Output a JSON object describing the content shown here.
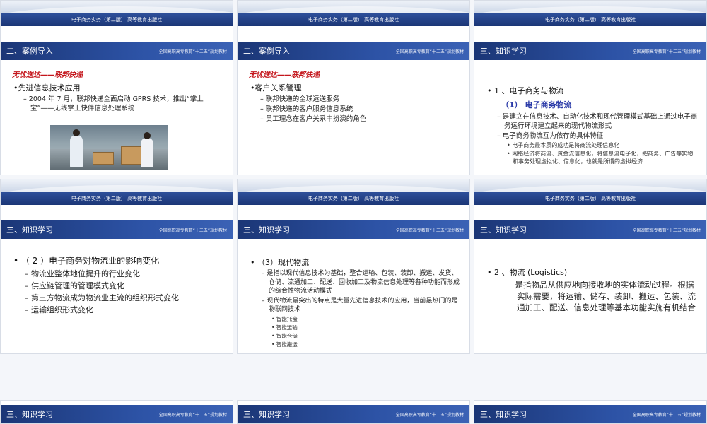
{
  "banner_text": "电子商务实务（第二版）   高等教育出版社",
  "title_note": "全国高职高专教育“十二五”规划教材",
  "slides": {
    "s1": {
      "section": "二、案例导入",
      "red_title": "无忧送达——联邦快递",
      "b1": "•先进信息技术应用",
      "b2": "– 2004 年 7 月，联邦快递全面启动 GPRS 技术，推出“掌上宝”——无线掌上快件信息处理系统"
    },
    "s2": {
      "section": "二、案例导入",
      "red_title": "无忧送达——联邦快递",
      "b1": "•客户关系管理",
      "b2": "– 联邦快递的全球运送服务",
      "b3": "– 联邦快递的客户服务信息系统",
      "b4": "– 员工理念在客户关系中扮演的角色"
    },
    "s3": {
      "section": "三、知识学习",
      "b1": "• 1 、电子商务与物流",
      "blue": "（1） 电子商务物流",
      "b2": "– 是建立在信息技术、自动化技术和现代管理模式基础上通过电子商务运行环境建立起来的现代物流形式",
      "b3": "– 电子商务物流互为依存的具体特征",
      "b4": "• 电子商务最本质的成功是将商流处理信息化",
      "b5": "• 网络经济将商流、资金流信息化，将信息流电子化，把商务、广告等实物和事务处理虚拟化、信息化，也就是所谓的虚拟经济"
    },
    "s4": {
      "section": "三、知识学习",
      "b1": "• （ 2 ）电子商务对物流业的影响变化",
      "b2": "– 物流业整体地位提升的行业变化",
      "b3": "– 供应链管理的管理模式变化",
      "b4": "– 第三方物流成为物流业主流的组织形式变化",
      "b5": "– 运输组织形式变化"
    },
    "s5": {
      "section": "三、知识学习",
      "b1": "• （3）现代物流",
      "b2": "– 是指以现代信息技术为基础，整合运输、包装、装卸、搬运、发货、仓储、流通加工、配送、回收加工及物流信息处理等各种功能而形成的综合性物流活动模式",
      "b3": "– 现代物流最突出的特点是大量先进信息技术的应用，当前最热门的是物联网技术",
      "b4": "• 智能托盘",
      "b5": "• 智能运输",
      "b6": "• 智能仓储",
      "b7": "• 智能搬运"
    },
    "s6": {
      "section": "三、知识学习",
      "b1": "• 2 、物流 (Logistics)",
      "b2": "– 是指物品从供应地向接收地的实体流动过程。根据实际需要，将运输、储存、装卸、搬运、包装、流通加工、配送、信息处理等基本功能实施有机结合"
    },
    "s7": {
      "section": "三、知识学习"
    },
    "s8": {
      "section": "三、知识学习"
    },
    "s9": {
      "section": "三、知识学习"
    }
  }
}
